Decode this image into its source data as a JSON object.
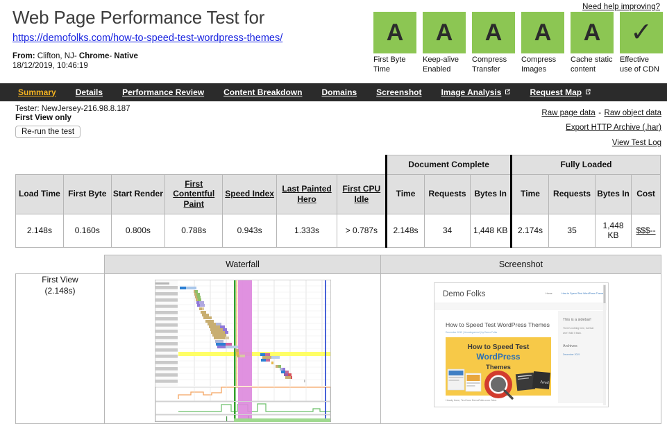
{
  "header": {
    "title": "Web Page Performance Test for",
    "url": "https://demofolks.com/how-to-speed-test-wordpress-themes/",
    "from_label": "From:",
    "from_location": "Clifton, NJ",
    "sep1": "-",
    "browser": "Chrome",
    "sep2": "-",
    "connection": "Native",
    "timestamp": "18/12/2019, 10:46:19",
    "need_help_link": "Need help improving?"
  },
  "grades": [
    {
      "grade": "A",
      "label": "First Byte Time",
      "color": "#8cc653"
    },
    {
      "grade": "A",
      "label": "Keep-alive Enabled",
      "color": "#8cc653"
    },
    {
      "grade": "A",
      "label": "Compress Transfer",
      "color": "#8cc653"
    },
    {
      "grade": "A",
      "label": "Compress Images",
      "color": "#8cc653"
    },
    {
      "grade": "A",
      "label": "Cache static content",
      "color": "#8cc653"
    },
    {
      "grade": "✓",
      "label": "Effective use of CDN",
      "color": "#8cc653"
    }
  ],
  "nav": {
    "active_color": "#f4b321",
    "background": "#2b2b2b",
    "tabs": [
      {
        "label": "Summary",
        "active": true,
        "external": false
      },
      {
        "label": "Details",
        "active": false,
        "external": false
      },
      {
        "label": "Performance Review",
        "active": false,
        "external": false
      },
      {
        "label": "Content Breakdown",
        "active": false,
        "external": false
      },
      {
        "label": "Domains",
        "active": false,
        "external": false
      },
      {
        "label": "Screenshot",
        "active": false,
        "external": false
      },
      {
        "label": "Image Analysis",
        "active": false,
        "external": true
      },
      {
        "label": "Request Map",
        "active": false,
        "external": true
      }
    ]
  },
  "info": {
    "tester": "Tester: NewJersey-216.98.8.187",
    "first_view_only": "First View only",
    "rerun_button": "Re-run the test",
    "links": {
      "raw_page_data": "Raw page data",
      "dash": "-",
      "raw_object_data": "Raw object data",
      "export_har": "Export HTTP Archive (.har)",
      "view_test_log": "View Test Log"
    }
  },
  "results_table": {
    "group_headers": [
      {
        "label": "Document Complete",
        "span": 3
      },
      {
        "label": "Fully Loaded",
        "span": 4
      }
    ],
    "columns": [
      {
        "label": "Load Time",
        "underline": false
      },
      {
        "label": "First Byte",
        "underline": false
      },
      {
        "label": "Start Render",
        "underline": false
      },
      {
        "label": "First Contentful Paint",
        "underline": true
      },
      {
        "label": "Speed Index",
        "underline": true
      },
      {
        "label": "Last Painted Hero",
        "underline": true
      },
      {
        "label": "First CPU Idle",
        "underline": true
      },
      {
        "label": "Time",
        "underline": false
      },
      {
        "label": "Requests",
        "underline": false
      },
      {
        "label": "Bytes In",
        "underline": false
      },
      {
        "label": "Time",
        "underline": false
      },
      {
        "label": "Requests",
        "underline": false
      },
      {
        "label": "Bytes In",
        "underline": false
      },
      {
        "label": "Cost",
        "underline": false
      }
    ],
    "row": {
      "load_time": "2.148s",
      "first_byte": "0.160s",
      "start_render": "0.800s",
      "first_contentful_paint": "0.788s",
      "speed_index": "0.943s",
      "last_painted_hero": "1.333s",
      "first_cpu_idle": "> 0.787s",
      "dc_time": "2.148s",
      "dc_requests": "34",
      "dc_bytes_in": "1,448 KB",
      "fl_time": "2.174s",
      "fl_requests": "35",
      "fl_bytes_in": "1,448 KB",
      "cost": "$$$--"
    }
  },
  "bottom_table": {
    "waterfall_header": "Waterfall",
    "screenshot_header": "Screenshot",
    "view_label_line1": "First View",
    "view_label_line2": "(2.148s)"
  },
  "screenshot_thumb": {
    "site_title": "Demo Folks",
    "nav_home": "Home",
    "nav_page": "How to Speed Test WordPress Themes",
    "post_title": "How to Speed Test WordPress Themes",
    "post_meta": "December 2019 | Uncategorized | by Demo Folks",
    "hero_line1": "How to Speed Test",
    "hero_line2": "WordPress",
    "hero_line3": "Themes",
    "footer_text": "Howdy there, Test from DemoFolks.com. Nice.",
    "sidebar_title": "This is a sidebar!",
    "sidebar_body": "There's nothing here, but that won't hold it back.",
    "sidebar_archives": "Archives",
    "sidebar_archive_link": "December 2019"
  },
  "waterfall_colors": {
    "dns": "#1f78b4",
    "connect": "#ff7f00",
    "ssl": "#a855c7",
    "html": "#2b7fd4",
    "js": "#c8ae71",
    "css": "#8f77d8",
    "image": "#b0b6d8",
    "font": "#d060a0",
    "start_render": "#33a02c",
    "doc_complete": "#d87fd8",
    "fully_loaded": "#1f4fd8",
    "speed_index_band": "#ffff66",
    "cpu": "#f4b183",
    "bandwidth": "#4caf50"
  }
}
